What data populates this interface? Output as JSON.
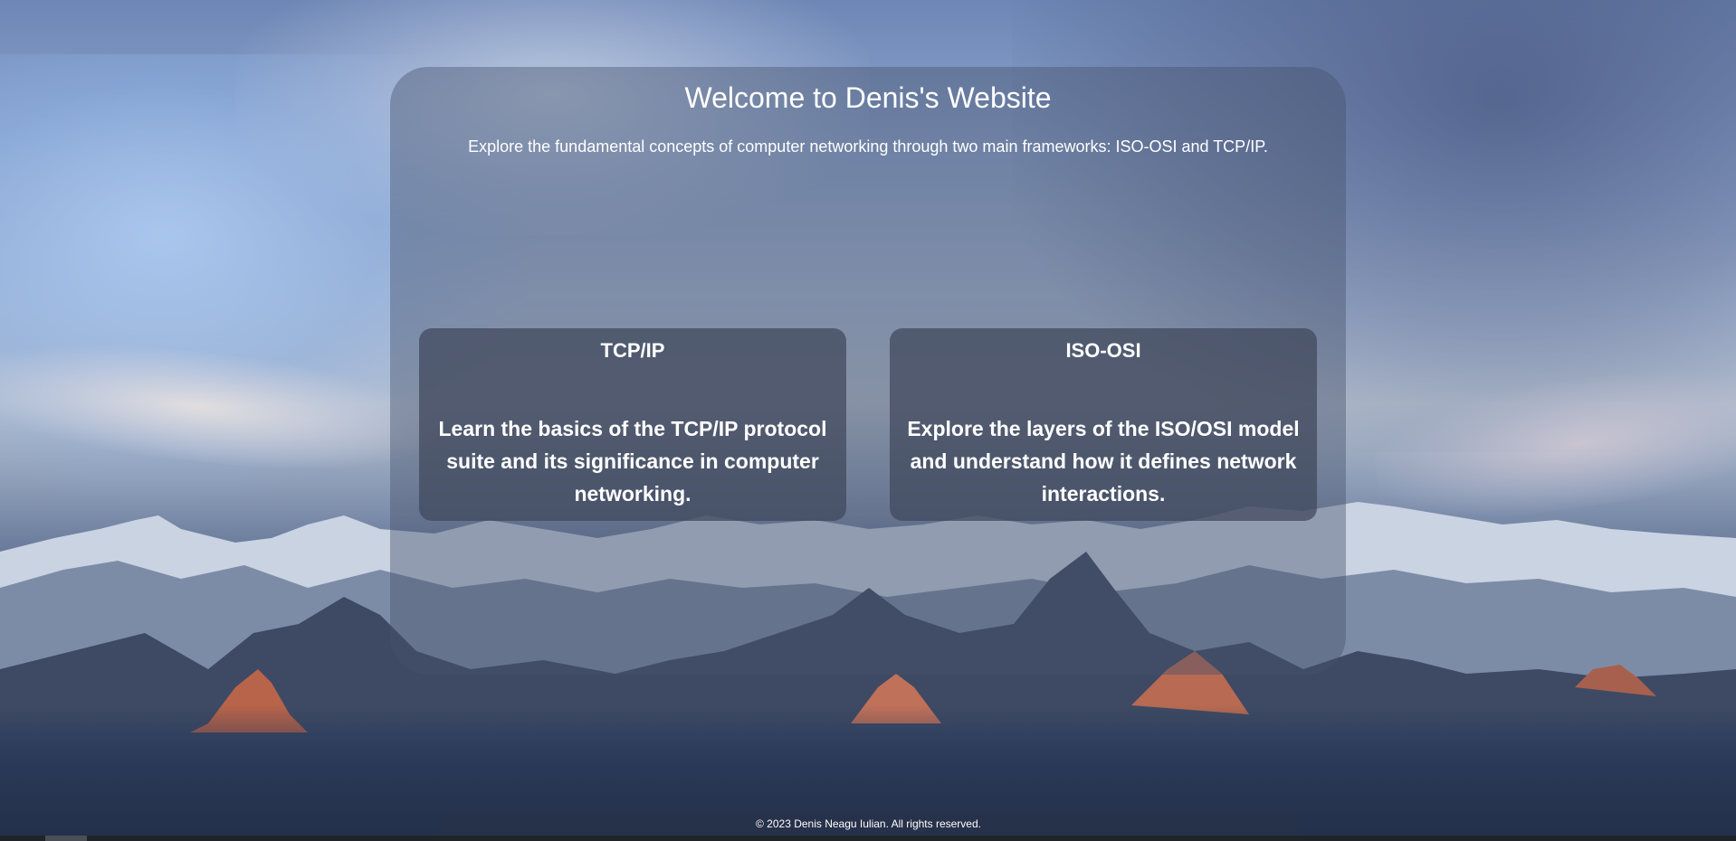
{
  "page": {
    "title": "Welcome to Denis's Website",
    "intro": "Explore the fundamental concepts of computer networking through two main frameworks: ISO-OSI and TCP/IP."
  },
  "cards": [
    {
      "title": "TCP/IP",
      "description": "Learn the basics of the TCP/IP protocol suite and its significance in computer networking."
    },
    {
      "title": "ISO-OSI",
      "description": "Explore the layers of the ISO/OSI model and understand how it defines network interactions."
    }
  ],
  "footer": {
    "text": "© 2023 Denis Neagu Iulian. All rights reserved."
  },
  "colors": {
    "text": "#ffffff",
    "panel": "rgba(70, 82, 108, 0.42)",
    "card": "rgba(62, 70, 90, 0.72)"
  }
}
